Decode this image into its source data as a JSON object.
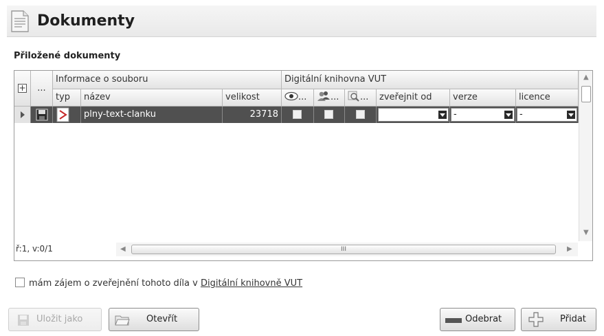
{
  "header": {
    "title": "Dokumenty",
    "icon": "document-icon"
  },
  "section": {
    "label": "Přiložené dokumenty"
  },
  "grid": {
    "expand_symbol": "+",
    "more_symbol": "...",
    "group_headers": [
      "Informace o souboru",
      "Digitální knihovna VUT"
    ],
    "columns": {
      "typ": "typ",
      "nazev": "název",
      "velikost": "velikost",
      "col_visibility": "...",
      "col_persons": "...",
      "col_search": "...",
      "zverejnit": "zveřejnit od",
      "verze": "verze",
      "licence": "licence"
    },
    "rows": [
      {
        "nazev": "plny-text-clanku",
        "velikost": "23718",
        "zverejnit": "",
        "verze": "-",
        "licence": "-"
      }
    ],
    "status": "ř:1, v:0/1",
    "hscroll_grip": "III"
  },
  "interest": {
    "label": "mám zájem o zveřejnění tohoto díla v ",
    "link": "Digitální knihovně VUT"
  },
  "buttons": {
    "save_as": "Uložit jako",
    "open": "Otevřít",
    "remove": "Odebrat",
    "add": "Přidat"
  },
  "colors": {
    "selected_row": "#505050",
    "header_bg": "#ececec"
  }
}
